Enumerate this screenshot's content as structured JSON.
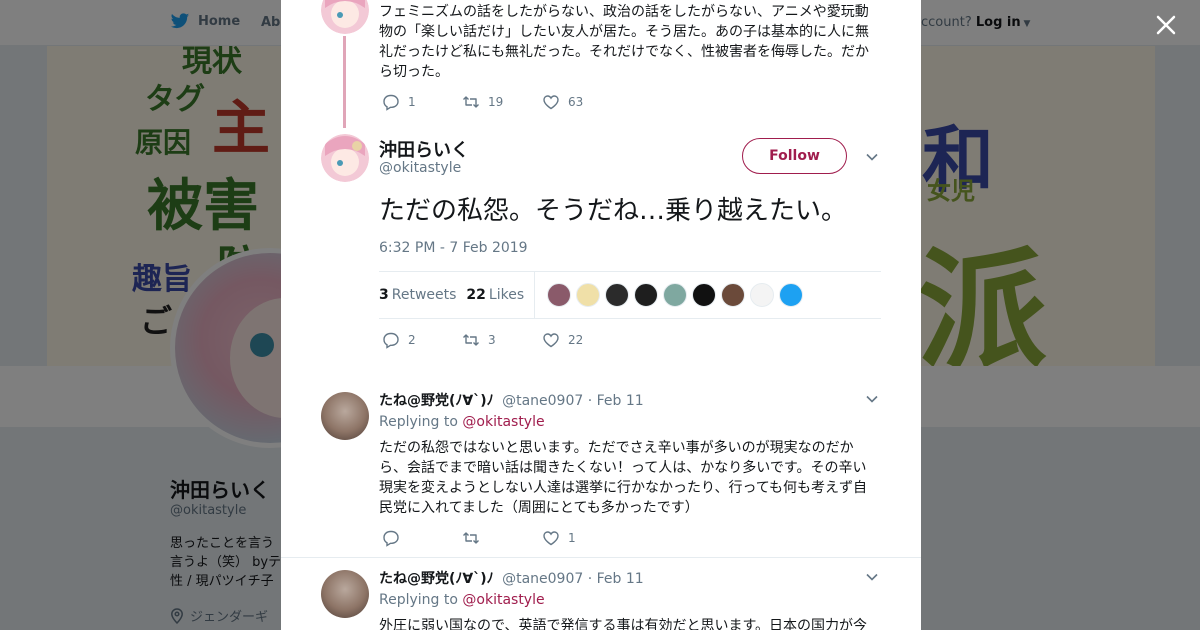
{
  "nav": {
    "home_label": "Home",
    "about_label": "Abo",
    "login_prefix": "ccount?",
    "login_label": "Log in"
  },
  "banner_words": [
    "現状",
    "タグ",
    "主",
    "原因",
    "被害",
    "防",
    "趣旨",
    "ご",
    "和",
    "女児",
    "派"
  ],
  "profile": {
    "name": "沖田らいく",
    "handle": "@okitastyle",
    "bio": "思ったことを言う言うよ（笑） byテ性 / 現パツイチ子",
    "location": "ジェンダーギ"
  },
  "parent_tweet": {
    "text": "フェミニズムの話をしたがらない、政治の話をしたがらない、アニメや愛玩動物の「楽しい話だけ」したい友人が居た。そう居た。あの子は基本的に人に無礼だったけど私にも無礼だった。それだけでなく、性被害者を侮辱した。だから切った。",
    "replies": "1",
    "retweets": "19",
    "likes": "63"
  },
  "main_tweet": {
    "name": "沖田らいく",
    "handle": "@okitastyle",
    "follow_label": "Follow",
    "text": "ただの私怨。そうだね…乗り越えたい。",
    "date": "6:32 PM - 7 Feb 2019",
    "retweets_count": "3",
    "retweets_label": "Retweets",
    "likes_count": "22",
    "likes_label": "Likes",
    "liker_colors": [
      "#8a5a6a",
      "#f0e0a8",
      "#2b2b2b",
      "#1e1e1e",
      "#7fa8a0",
      "#111111",
      "#6b4a3a",
      "#f4f4f4",
      "#1da1f2"
    ],
    "replies": "2",
    "retweets": "3",
    "likes": "22"
  },
  "replies": [
    {
      "name": "たね@野党(ﾉ∀`)ﾉ",
      "handle": "@tane0907",
      "date": "· Feb 11",
      "replying_label": "Replying to",
      "replying_to": "@okitastyle",
      "text": "ただの私怨ではないと思います。ただでさえ辛い事が多いのが現実なのだから、会話でまで暗い話は聞きたくない！って人は、かなり多いです。その辛い現実を変えようとしない人達は選挙に行かなかったり、行っても何も考えず自民党に入れてました（周囲にとても多かったです）",
      "replies": "",
      "retweets": "",
      "likes": "1"
    },
    {
      "name": "たね@野党(ﾉ∀`)ﾉ",
      "handle": "@tane0907",
      "date": "· Feb 11",
      "replying_label": "Replying to",
      "replying_to": "@okitastyle",
      "text": "外圧に弱い国なので、英語で発信する事は有効だと思います。日本の国力が今"
    }
  ]
}
